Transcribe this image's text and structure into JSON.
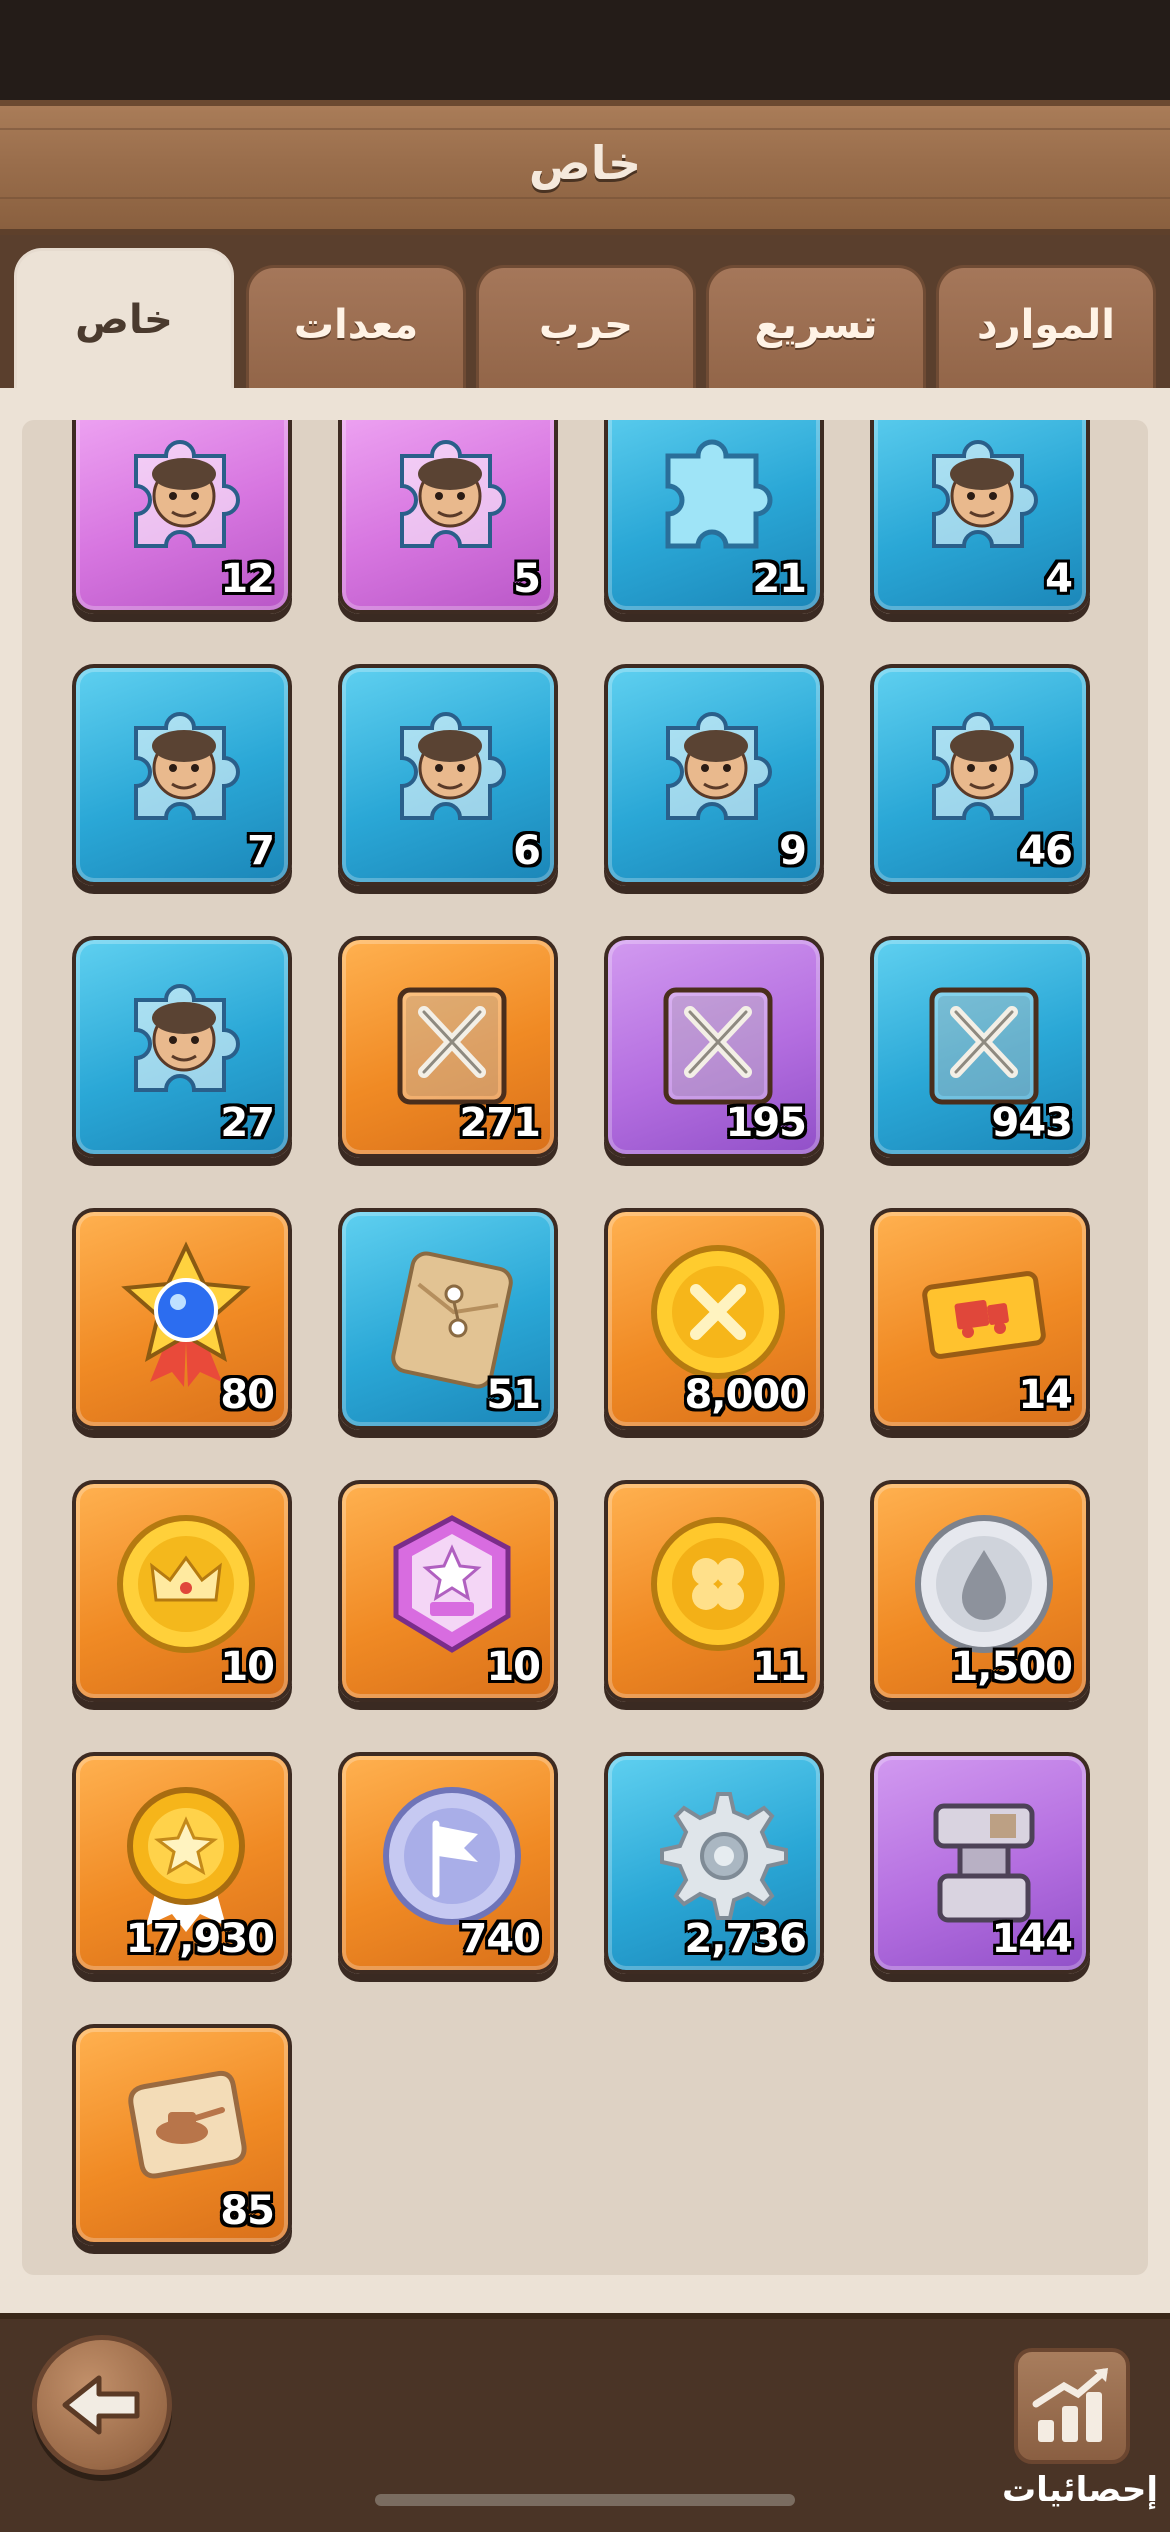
{
  "header": {
    "title": "خاص"
  },
  "tabs": [
    {
      "label": "خاص",
      "active": true
    },
    {
      "label": "معدات",
      "active": false
    },
    {
      "label": "حرب",
      "active": false
    },
    {
      "label": "تسريع",
      "active": false
    },
    {
      "label": "الموارد",
      "active": false
    }
  ],
  "items": [
    {
      "name": "hero-fragment-bearded-warrior",
      "color": "purple",
      "icon": "puzzle-hero-icon",
      "qty": "12"
    },
    {
      "name": "hero-fragment-hooded-mage",
      "color": "purple",
      "icon": "puzzle-hero-icon",
      "qty": "5"
    },
    {
      "name": "blank-puzzle-fragment",
      "color": "blue",
      "icon": "puzzle-piece-icon",
      "qty": "21"
    },
    {
      "name": "hero-fragment-dark-hair-woman",
      "color": "blue",
      "icon": "puzzle-hero-icon",
      "qty": "4"
    },
    {
      "name": "hero-fragment-angry-man",
      "color": "blue",
      "icon": "puzzle-hero-icon",
      "qty": "7"
    },
    {
      "name": "hero-fragment-bearded-man",
      "color": "blue",
      "icon": "puzzle-hero-icon",
      "qty": "6"
    },
    {
      "name": "hero-fragment-old-man",
      "color": "blue",
      "icon": "puzzle-hero-icon",
      "qty": "9"
    },
    {
      "name": "hero-fragment-blonde-woman",
      "color": "blue",
      "icon": "puzzle-hero-icon",
      "qty": "46"
    },
    {
      "name": "hero-fragment-red-hair-woman",
      "color": "blue",
      "icon": "puzzle-hero-icon",
      "qty": "27"
    },
    {
      "name": "orange-skill-book",
      "color": "orange",
      "icon": "skill-book-icon",
      "qty": "271"
    },
    {
      "name": "purple-skill-book",
      "color": "violet",
      "icon": "skill-book-icon",
      "qty": "195"
    },
    {
      "name": "blue-skill-book",
      "color": "blue",
      "icon": "skill-book-icon",
      "qty": "943"
    },
    {
      "name": "star-medal",
      "color": "orange",
      "icon": "star-medal-icon",
      "qty": "80"
    },
    {
      "name": "envelope",
      "color": "blue",
      "icon": "envelope-icon",
      "qty": "51"
    },
    {
      "name": "swords-coin",
      "color": "orange",
      "icon": "swords-coin-icon",
      "qty": "8,000"
    },
    {
      "name": "truck-ticket",
      "color": "orange",
      "icon": "truck-ticket-icon",
      "qty": "14"
    },
    {
      "name": "crown-coin",
      "color": "orange",
      "icon": "crown-coin-icon",
      "qty": "10"
    },
    {
      "name": "rank-badge",
      "color": "orange",
      "icon": "rank-badge-icon",
      "qty": "10"
    },
    {
      "name": "clover-coin",
      "color": "orange",
      "icon": "clover-coin-icon",
      "qty": "11"
    },
    {
      "name": "oil-drop-coin",
      "color": "orange",
      "icon": "oil-drop-coin-icon",
      "qty": "1,500"
    },
    {
      "name": "gold-star-medal",
      "color": "orange",
      "icon": "gold-medal-icon",
      "qty": "17,930"
    },
    {
      "name": "flag-coin",
      "color": "orange",
      "icon": "flag-coin-icon",
      "qty": "740"
    },
    {
      "name": "gear",
      "color": "blue",
      "icon": "gear-icon",
      "qty": "2,736"
    },
    {
      "name": "anvil",
      "color": "violet",
      "icon": "anvil-icon",
      "qty": "144"
    },
    {
      "name": "tank-scroll",
      "color": "orange",
      "icon": "scroll-icon",
      "qty": "85"
    }
  ],
  "footer": {
    "stats_label": "إحصائيات"
  }
}
